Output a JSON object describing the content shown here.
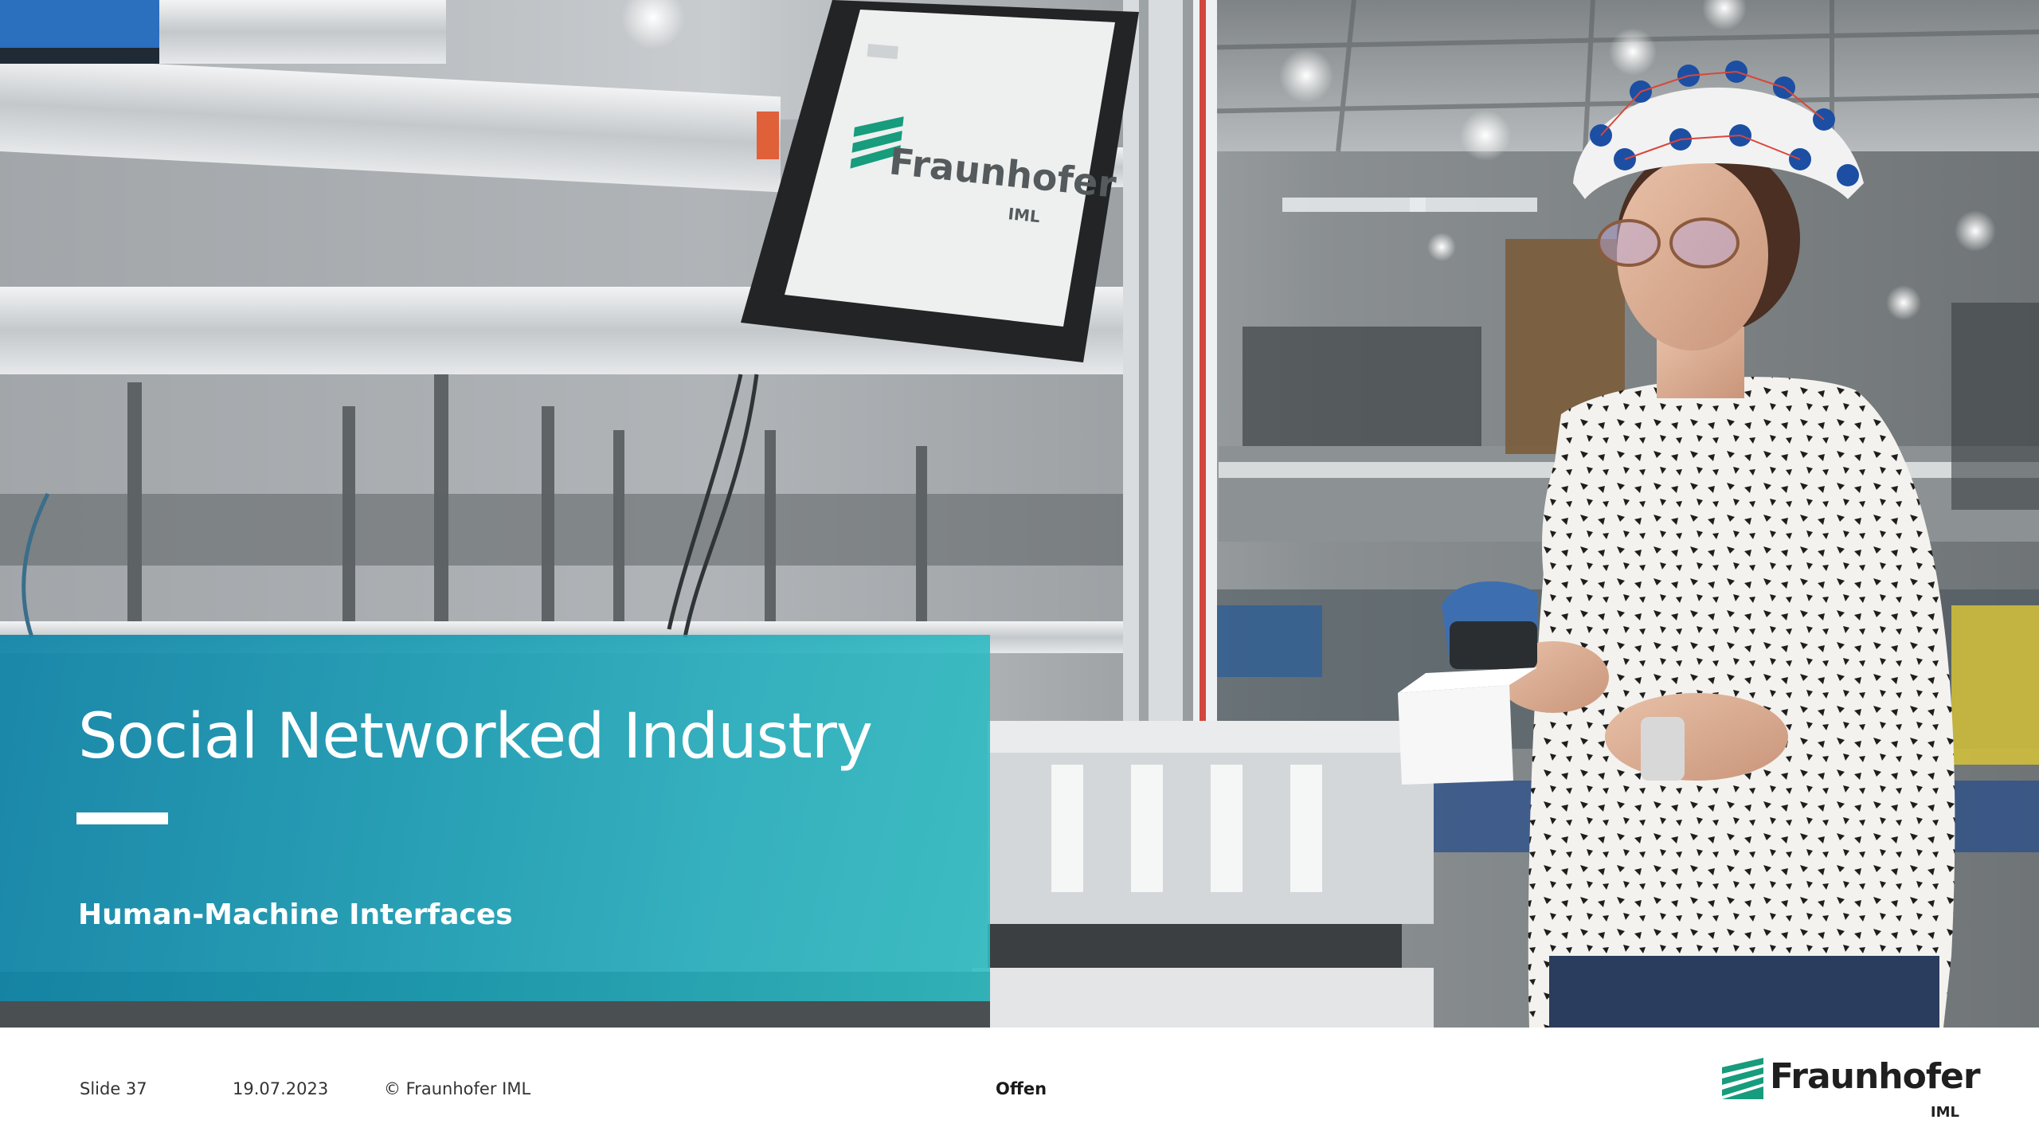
{
  "slide": {
    "title": "Social Networked Industry",
    "subtitle": "Human-Machine Interfaces"
  },
  "photo": {
    "monitor_logo_text": "Fraunhofer",
    "monitor_logo_sub": "IML"
  },
  "footer": {
    "slide_number": "Slide 37",
    "date": "19.07.2023",
    "copyright": "© Fraunhofer IML",
    "classification": "Offen"
  },
  "logo": {
    "name": "Fraunhofer",
    "institute": "IML",
    "icon": "fraunhofer-stripes-icon"
  },
  "colors": {
    "brand_green": "#179c7d",
    "panel_teal": "#1a9db4",
    "text_dark": "#1f1f1f"
  }
}
